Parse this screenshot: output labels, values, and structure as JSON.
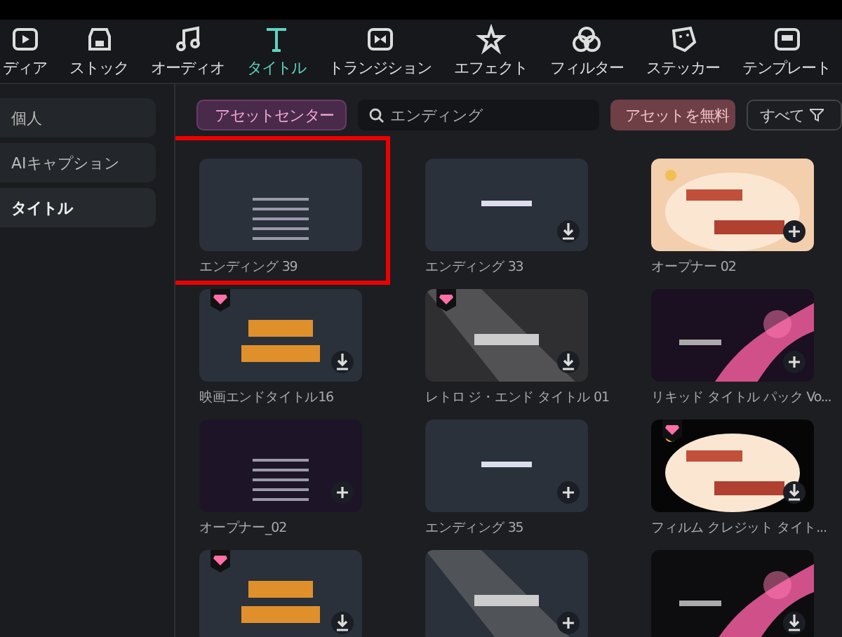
{
  "tabs": [
    {
      "label": "ディア",
      "selected": false
    },
    {
      "label": "ストック",
      "selected": false
    },
    {
      "label": "オーディオ",
      "selected": false
    },
    {
      "label": "タイトル",
      "selected": true
    },
    {
      "label": "トランジション",
      "selected": false
    },
    {
      "label": "エフェクト",
      "selected": false
    },
    {
      "label": "フィルター",
      "selected": false
    },
    {
      "label": "ステッカー",
      "selected": false
    },
    {
      "label": "テンプレート",
      "selected": false
    }
  ],
  "sidebar": {
    "items": [
      {
        "label": "個人",
        "selected": false
      },
      {
        "label": "AIキャプション",
        "selected": false
      },
      {
        "label": "タイトル",
        "selected": true
      }
    ]
  },
  "toolbar": {
    "asset_center": "アセットセンター",
    "search": {
      "value": "エンディング"
    },
    "free_assets": "アセットを無料",
    "filter": "すべて"
  },
  "cards": [
    {
      "label": "エンディング 39",
      "premium": false,
      "downloadable": false,
      "addable": false,
      "highlighted": true
    },
    {
      "label": "エンディング 33",
      "premium": false,
      "downloadable": true,
      "addable": false,
      "highlighted": false
    },
    {
      "label": "オープナー 02",
      "premium": false,
      "downloadable": false,
      "addable": true,
      "highlighted": false
    },
    {
      "label": "映画エンドタイトル16",
      "premium": true,
      "downloadable": true,
      "addable": false,
      "highlighted": false
    },
    {
      "label": "レトロ ジ・エンド タイトル 01",
      "premium": true,
      "downloadable": true,
      "addable": false,
      "highlighted": false
    },
    {
      "label": "リキッド タイトル パック Vo...",
      "premium": false,
      "downloadable": false,
      "addable": true,
      "highlighted": false
    },
    {
      "label": "オープナー_02",
      "premium": false,
      "downloadable": false,
      "addable": true,
      "highlighted": false
    },
    {
      "label": "エンディング 35",
      "premium": false,
      "downloadable": false,
      "addable": true,
      "highlighted": false
    },
    {
      "label": "フィルム クレジット タイト...",
      "premium": true,
      "downloadable": true,
      "addable": false,
      "highlighted": false
    },
    {
      "premium": true,
      "downloadable": true,
      "addable": false,
      "highlighted": false
    },
    {
      "premium": false,
      "downloadable": false,
      "addable": true,
      "highlighted": false
    },
    {
      "premium": false,
      "downloadable": true,
      "addable": false,
      "highlighted": false
    }
  ]
}
